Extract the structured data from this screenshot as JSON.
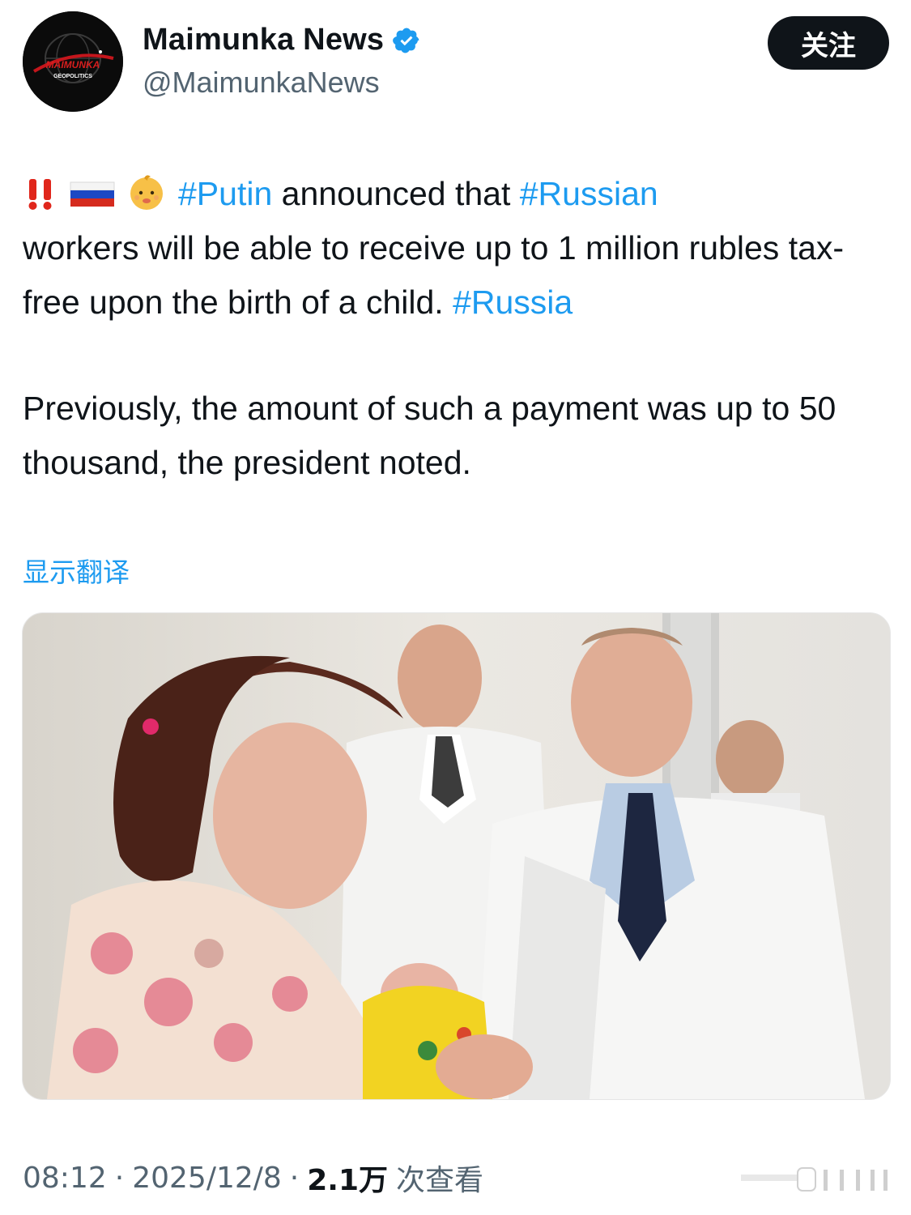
{
  "account": {
    "display_name": "Maimunka News",
    "handle": "@MaimunkaNews",
    "avatar_text_line1": "MAIMUNKA",
    "avatar_text_line2": "GEOPOLITICS",
    "verified_color": "#1d9bf0"
  },
  "follow_label": "关注",
  "tweet": {
    "emojis": [
      "double-exclamation-icon",
      "russia-flag-icon",
      "baby-icon"
    ],
    "line1_hashtag1": "#Putin",
    "line1_text": " announced that ",
    "line1_hashtag2": "#Russian",
    "line2_text": "workers will be able to receive up to 1 million rubles tax-free upon the birth of a child. ",
    "line2_hashtag": "#Russia",
    "paragraph2": "Previously, the amount of such a payment was up to 50 thousand, the president noted."
  },
  "translate_label": "显示翻译",
  "meta": {
    "time": "08:12",
    "sep1": "·",
    "date": "2025/12/8",
    "sep2": "·",
    "views_count": "2.1万",
    "views_label": "次查看"
  },
  "colors": {
    "link": "#1d9bf0",
    "muted": "#536471",
    "button_bg": "#0f1419"
  }
}
